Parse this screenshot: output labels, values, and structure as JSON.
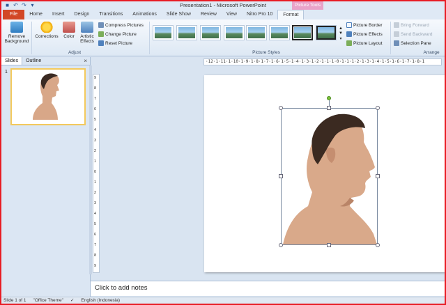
{
  "window": {
    "title": "Presentation1 - Microsoft PowerPoint",
    "context_tab": "Picture Tools"
  },
  "tabs": [
    "File",
    "Home",
    "Insert",
    "Design",
    "Transitions",
    "Animations",
    "Slide Show",
    "Review",
    "View",
    "Nitro Pro 10",
    "Format"
  ],
  "ribbon": {
    "remove_background": "Remove Background",
    "corrections": "Corrections",
    "color": "Color",
    "artistic_effects": "Artistic Effects",
    "compress_pictures": "Compress Pictures",
    "change_picture": "Change Picture",
    "reset_picture": "Reset Picture",
    "adjust_label": "Adjust",
    "picture_styles_label": "Picture Styles",
    "picture_border": "Picture Border",
    "picture_effects": "Picture Effects",
    "picture_layout": "Picture Layout",
    "bring_forward": "Bring Forward",
    "send_backward": "Send Backward",
    "selection_pane": "Selection Pane",
    "arrange_label": "Arrange"
  },
  "left_pane": {
    "tab_slides": "Slides",
    "tab_outline": "Outline",
    "close": "×",
    "slide_number": "1"
  },
  "ruler_text": "·12·1·11·1·10·1·9·1·8·1·7·1·6·1·5·1·4·1·3·1·2·1·1·1·0·1·1·1·2·1·3·1·4·1·5·1·6·1·7·1·8·1",
  "vruler_ticks": [
    "9",
    "8",
    "7",
    "6",
    "5",
    "4",
    "3",
    "2",
    "1",
    "0",
    "1",
    "2",
    "3",
    "4",
    "5",
    "6",
    "7",
    "8",
    "9"
  ],
  "notes_placeholder": "Click to add notes",
  "status": {
    "slide": "Slide 1 of 1",
    "theme": "\"Office Theme\"",
    "language": "English (Indonesia)"
  }
}
